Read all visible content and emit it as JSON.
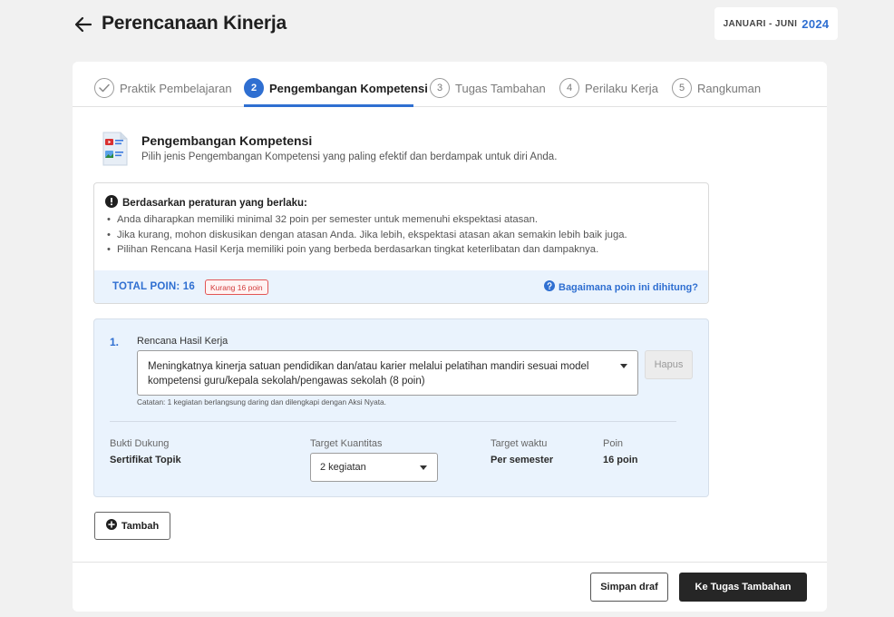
{
  "header": {
    "title": "Perencanaan Kinerja",
    "period_label": "JANUARI - JUNI",
    "period_year": "2024"
  },
  "stepper": {
    "steps": [
      {
        "marker": "",
        "label": "Praktik Pembelajaran",
        "state": "done"
      },
      {
        "marker": "2",
        "label": "Pengembangan Kompetensi",
        "state": "active"
      },
      {
        "marker": "3",
        "label": "Tugas Tambahan",
        "state": "pending"
      },
      {
        "marker": "4",
        "label": "Perilaku Kerja",
        "state": "pending"
      },
      {
        "marker": "5",
        "label": "Rangkuman",
        "state": "pending"
      }
    ]
  },
  "section": {
    "icon": "document-media-icon",
    "title": "Pengembangan Kompetensi",
    "description": "Pilih jenis Pengembangan Kompetensi yang paling efektif dan berdampak untuk diri Anda."
  },
  "info": {
    "heading": "Berdasarkan peraturan yang berlaku:",
    "items": [
      "Anda diharapkan memiliki minimal 32 poin per semester untuk memenuhi ekspektasi atasan.",
      "Jika kurang, mohon diskusikan dengan atasan Anda. Jika lebih, ekspektasi atasan akan semakin lebih baik juga.",
      "Pilihan Rencana Hasil Kerja memiliki poin yang berbeda berdasarkan tingkat keterlibatan dan dampaknya."
    ],
    "total_points": "TOTAL POIN: 16",
    "badge": "Kurang 16 poin",
    "help_link": "Bagaimana poin ini dihitung?"
  },
  "plan": {
    "number": "1.",
    "label": "Rencana Hasil Kerja",
    "selected": "Meningkatnya kinerja satuan pendidikan dan/atau karier melalui pelatihan mandiri sesuai model kompetensi guru/kepala sekolah/pengawas sekolah (8 poin)",
    "delete_label": "Hapus",
    "note": "Catatan: 1 kegiatan berlangsung daring dan dilengkapi dengan Aksi Nyata.",
    "evidence_label": "Bukti Dukung",
    "evidence_value": "Sertifikat Topik",
    "quantity_label": "Target Kuantitas",
    "quantity_value": "2 kegiatan",
    "time_label": "Target waktu",
    "time_value": "Per semester",
    "points_label": "Poin",
    "points_value": "16 poin"
  },
  "actions": {
    "add_label": "Tambah",
    "draft_label": "Simpan draf",
    "next_label": "Ke Tugas Tambahan"
  },
  "colors": {
    "accent": "#2f6fd1",
    "panel": "#eaf3fd",
    "warning": "#d23c3c",
    "primary_button": "#262626"
  }
}
